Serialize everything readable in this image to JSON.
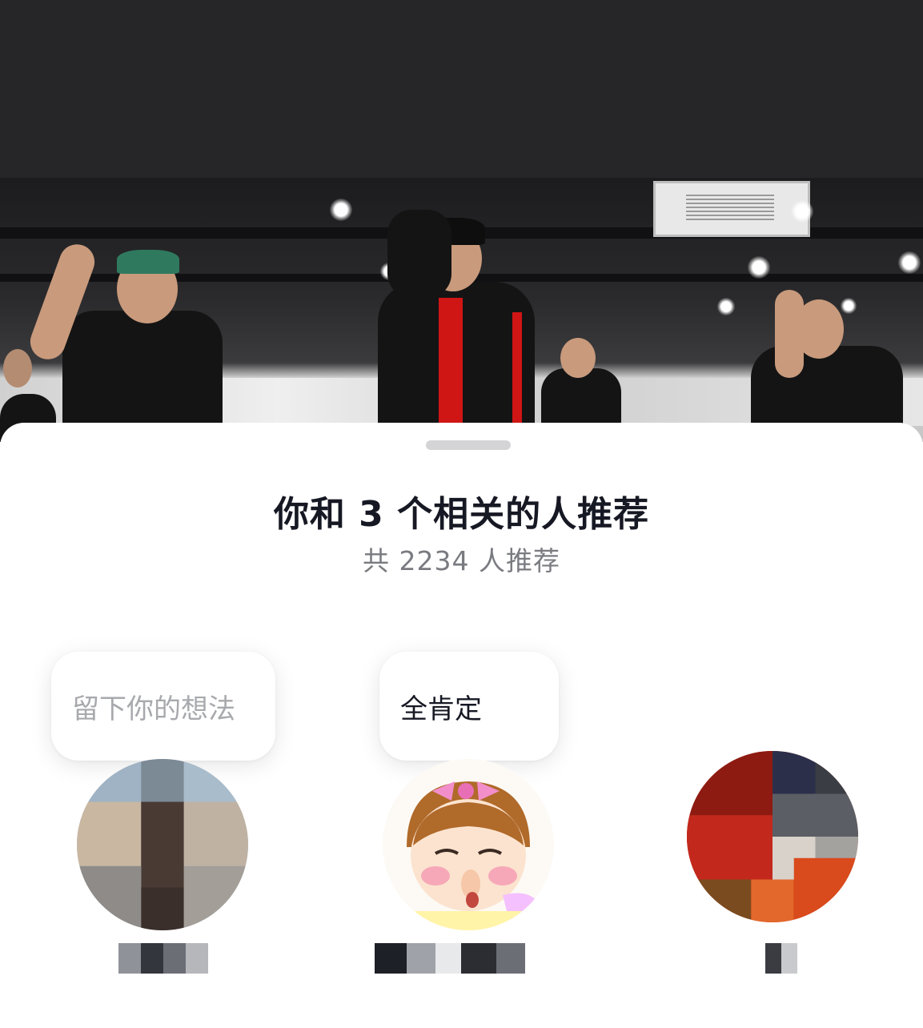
{
  "sheet": {
    "title": "你和 3 个相关的人推荐",
    "subtitle": "共 2234 人推荐"
  },
  "recommenders": [
    {
      "comment": "留下你的想法",
      "comment_style": "placeholder",
      "name": ""
    },
    {
      "comment": "全肯定",
      "comment_style": "text",
      "name": ""
    },
    {
      "comment": "",
      "comment_style": "none",
      "name": ""
    }
  ],
  "colors": {
    "top_background": "#262628",
    "sheet_background": "#ffffff",
    "title_text": "#161823",
    "subtitle_text": "#7a7b80",
    "placeholder_text": "#a8a9ad",
    "handle": "#d4d4d6"
  },
  "icons": [
    "sheet-drag-handle"
  ]
}
